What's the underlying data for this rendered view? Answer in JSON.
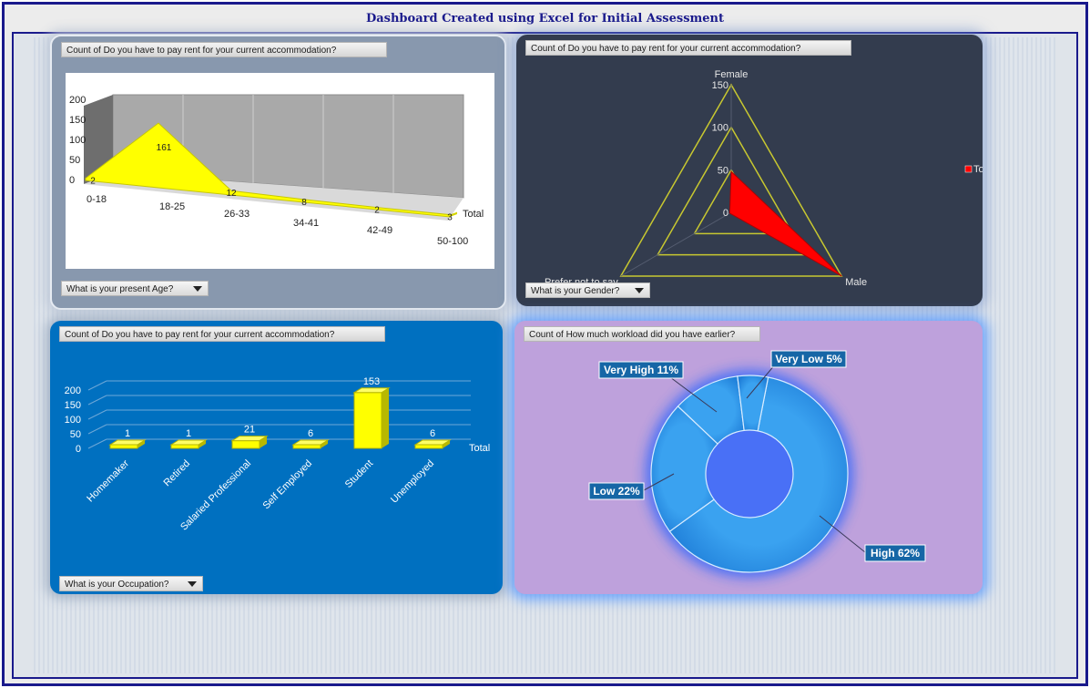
{
  "header": {
    "title": "Dashboard Created using Excel for Initial Assessment"
  },
  "colors": {
    "frame": "#1a1a8c",
    "area_fill": "#ffff00",
    "radar_fill": "#ff0000",
    "radar_lines": "#c8c830",
    "bar_fill": "#ffff00",
    "donut": "#3aa2f0",
    "callout": "#1666a6"
  },
  "panels": [
    {
      "title": "Count of Do you have to pay rent for your current accommodation?",
      "filter_label": "What is your present Age?",
      "chart_data": {
        "type": "area",
        "categories": [
          "0-18",
          "18-25",
          "26-33",
          "34-41",
          "42-49",
          "50-100"
        ],
        "series": [
          {
            "name": "Total",
            "values": [
              2,
              161,
              12,
              8,
              2,
              3
            ]
          }
        ],
        "yticks": [
          "0",
          "50",
          "100",
          "150",
          "200"
        ],
        "ylim": [
          0,
          200
        ]
      }
    },
    {
      "title": "Count of Do you have to pay rent for your current accommodation?",
      "filter_label": "What is your Gender?",
      "chart_data": {
        "type": "radar",
        "categories": [
          "Female",
          "Male",
          "Prefer not to say"
        ],
        "series": [
          {
            "name": "Total",
            "values": [
              48,
              150,
              2
            ]
          }
        ],
        "rticks": [
          "0",
          "50",
          "100",
          "150"
        ],
        "rlim": [
          0,
          150
        ],
        "legend": "right"
      }
    },
    {
      "title": "Count of Do you have to pay rent for your current accommodation?",
      "filter_label": "What is your Occupation?",
      "chart_data": {
        "type": "bar",
        "categories": [
          "Homemaker",
          "Retired",
          "Salaried Professional",
          "Self Employed",
          "Student",
          "Unemployed"
        ],
        "series": [
          {
            "name": "Total",
            "values": [
              1,
              1,
              21,
              6,
              153,
              6
            ]
          }
        ],
        "yticks": [
          "0",
          "50",
          "100",
          "150",
          "200"
        ],
        "ylim": [
          0,
          200
        ]
      }
    },
    {
      "title": "Count of How much workload did you have earlier?",
      "chart_data": {
        "type": "pie",
        "categories": [
          "High",
          "Low",
          "Very High",
          "Very Low"
        ],
        "values": [
          62,
          22,
          11,
          5
        ],
        "labels": [
          "High 62%",
          "Low 22%",
          "Very High 11%",
          "Very Low 5%"
        ]
      }
    }
  ]
}
